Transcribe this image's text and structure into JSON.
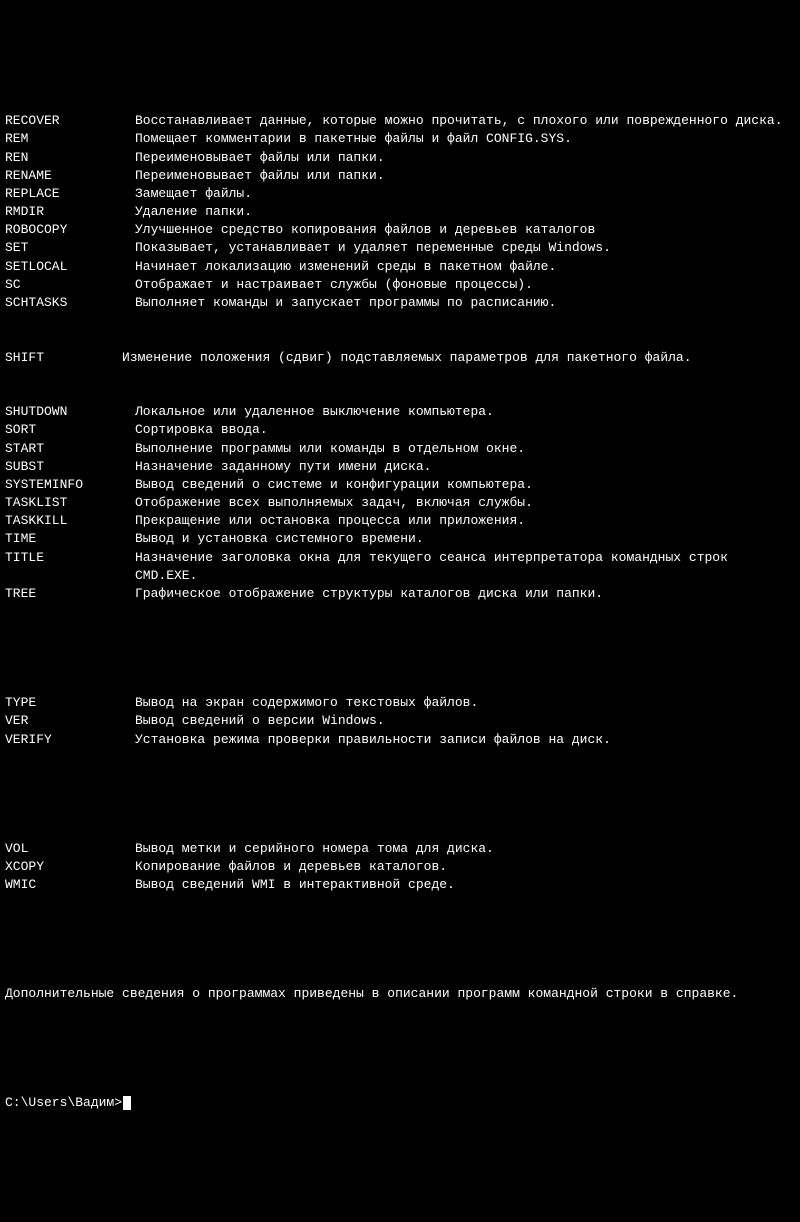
{
  "commands": [
    {
      "name": "RECOVER",
      "desc": "Восстанавливает данные, которые можно прочитать, с плохого или поврежденного диска."
    },
    {
      "name": "REM",
      "desc": "Помещает комментарии в пакетные файлы и файл CONFIG.SYS."
    },
    {
      "name": "REN",
      "desc": "Переименовывает файлы или папки."
    },
    {
      "name": "RENAME",
      "desc": "Переименовывает файлы или папки."
    },
    {
      "name": "REPLACE",
      "desc": "Замещает файлы."
    },
    {
      "name": "RMDIR",
      "desc": "Удаление папки."
    },
    {
      "name": "ROBOCOPY",
      "desc": "Улучшенное средство копирования файлов и деревьев каталогов"
    },
    {
      "name": "SET",
      "desc": "Показывает, устанавливает и удаляет переменные среды Windows."
    },
    {
      "name": "SETLOCAL",
      "desc": "Начинает локализацию изменений среды в пакетном файле."
    },
    {
      "name": "SC",
      "desc": "Отображает и настраивает службы (фоновые процессы)."
    },
    {
      "name": "SCHTASKS",
      "desc": "Выполняет команды и запускает программы по расписанию."
    }
  ],
  "shift": {
    "name": "SHIFT",
    "full": "SHIFT          Изменение положения (сдвиг) подставляемых параметров для пакетного файла."
  },
  "commands2": [
    {
      "name": "SHUTDOWN",
      "desc": "Локальное или удаленное выключение компьютера."
    },
    {
      "name": "SORT",
      "desc": "Сортировка ввода."
    },
    {
      "name": "START",
      "desc": "Выполнение программы или команды в отдельном окне."
    },
    {
      "name": "SUBST",
      "desc": "Назначение заданному пути имени диска."
    },
    {
      "name": "SYSTEMINFO",
      "desc": "Вывод сведений о системе и конфигурации компьютера."
    },
    {
      "name": "TASKLIST",
      "desc": "Отображение всех выполняемых задач, включая службы."
    },
    {
      "name": "TASKKILL",
      "desc": "Прекращение или остановка процесса или приложения."
    },
    {
      "name": "TIME",
      "desc": "Вывод и установка системного времени."
    },
    {
      "name": "TITLE",
      "desc": "Назначение заголовка окна для текущего сеанса интерпретатора командных строк CMD.EXE."
    },
    {
      "name": "TREE",
      "desc": "Графическое отображение структуры каталогов диска или папки."
    }
  ],
  "commands3": [
    {
      "name": "TYPE",
      "desc": "Вывод на экран содержимого текстовых файлов."
    },
    {
      "name": "VER",
      "desc": "Вывод сведений о версии Windows."
    },
    {
      "name": "VERIFY",
      "desc": "Установка режима проверки правильности записи файлов на диск."
    }
  ],
  "commands4": [
    {
      "name": "VOL",
      "desc": "Вывод метки и серийного номера тома для диска."
    },
    {
      "name": "XCOPY",
      "desc": "Копирование файлов и деревьев каталогов."
    },
    {
      "name": "WMIC",
      "desc": "Вывод сведений WMI в интерактивной среде."
    }
  ],
  "footer": "Дополнительные сведения о программах приведены в описании программ командной строки в справке.",
  "prompt": "C:\\Users\\Вадим>"
}
